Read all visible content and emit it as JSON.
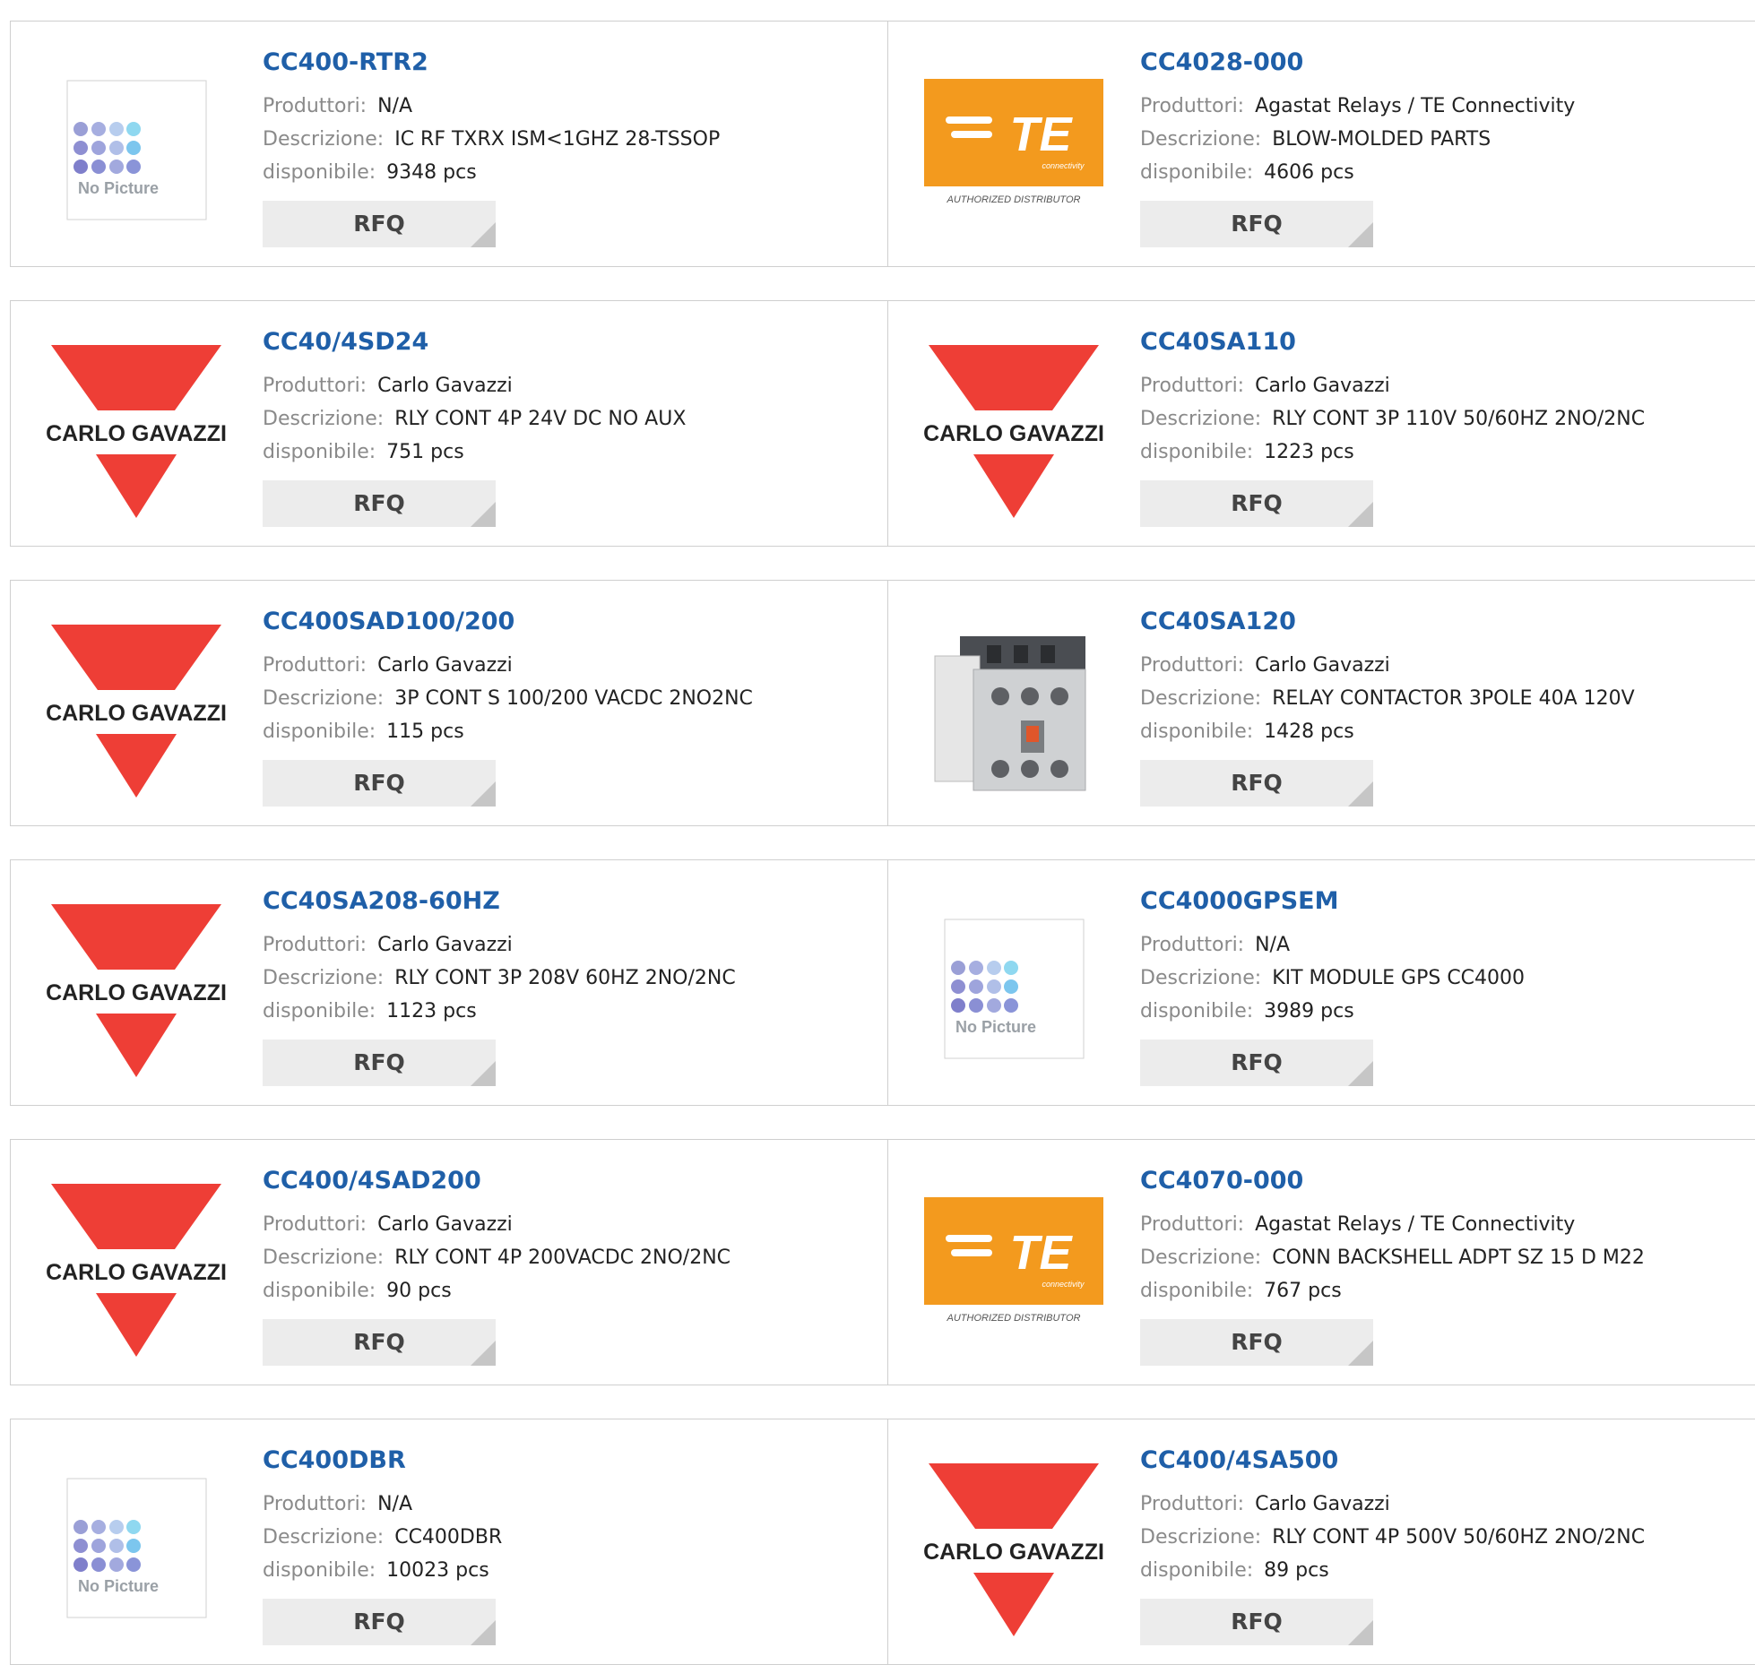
{
  "labels": {
    "manufacturer": "Produttori:",
    "description": "Descrizione:",
    "available": "disponibile:",
    "rfq": "RFQ"
  },
  "logos": {
    "no_picture": "No Picture",
    "carlo_gavazzi": "CARLO GAVAZZI",
    "te_mark": "TE",
    "te_sub": "connectivity",
    "te_tag": "AUTHORIZED DISTRIBUTOR"
  },
  "colors": {
    "link": "#1f5fa8",
    "gavazzi_red": "#ee3e36",
    "te_orange": "#f39a1e"
  },
  "products": [
    {
      "part": "CC400-RTR2",
      "manufacturer": "N/A",
      "description": "IC RF TXRX ISM<1GHZ 28-TSSOP",
      "available": "9348 pcs",
      "image": "no-picture"
    },
    {
      "part": "CC4028-000",
      "manufacturer": "Agastat Relays / TE Connectivity",
      "description": "BLOW-MOLDED PARTS",
      "available": "4606 pcs",
      "image": "te-logo"
    },
    {
      "part": "CC40/4SD24",
      "manufacturer": "Carlo Gavazzi",
      "description": "RLY CONT 4P 24V DC NO AUX",
      "available": "751 pcs",
      "image": "gavazzi-logo"
    },
    {
      "part": "CC40SA110",
      "manufacturer": "Carlo Gavazzi",
      "description": "RLY CONT 3P 110V 50/60HZ 2NO/2NC",
      "available": "1223 pcs",
      "image": "gavazzi-logo"
    },
    {
      "part": "CC400SAD100/200",
      "manufacturer": "Carlo Gavazzi",
      "description": "3P CONT S 100/200 VACDC 2NO2NC",
      "available": "115 pcs",
      "image": "gavazzi-logo"
    },
    {
      "part": "CC40SA120",
      "manufacturer": "Carlo Gavazzi",
      "description": "RELAY CONTACTOR 3POLE 40A 120V",
      "available": "1428 pcs",
      "image": "contactor-photo"
    },
    {
      "part": "CC40SA208-60HZ",
      "manufacturer": "Carlo Gavazzi",
      "description": "RLY CONT 3P 208V 60HZ 2NO/2NC",
      "available": "1123 pcs",
      "image": "gavazzi-logo"
    },
    {
      "part": "CC4000GPSEM",
      "manufacturer": "N/A",
      "description": "KIT MODULE GPS CC4000",
      "available": "3989 pcs",
      "image": "no-picture"
    },
    {
      "part": "CC400/4SAD200",
      "manufacturer": "Carlo Gavazzi",
      "description": "RLY CONT 4P 200VACDC 2NO/2NC",
      "available": "90 pcs",
      "image": "gavazzi-logo"
    },
    {
      "part": "CC4070-000",
      "manufacturer": "Agastat Relays / TE Connectivity",
      "description": "CONN BACKSHELL ADPT SZ 15 D M22",
      "available": "767 pcs",
      "image": "te-logo"
    },
    {
      "part": "CC400DBR",
      "manufacturer": "N/A",
      "description": "CC400DBR",
      "available": "10023 pcs",
      "image": "no-picture"
    },
    {
      "part": "CC400/4SA500",
      "manufacturer": "Carlo Gavazzi",
      "description": "RLY CONT 4P 500V 50/60HZ 2NO/2NC",
      "available": "89 pcs",
      "image": "gavazzi-logo"
    }
  ]
}
